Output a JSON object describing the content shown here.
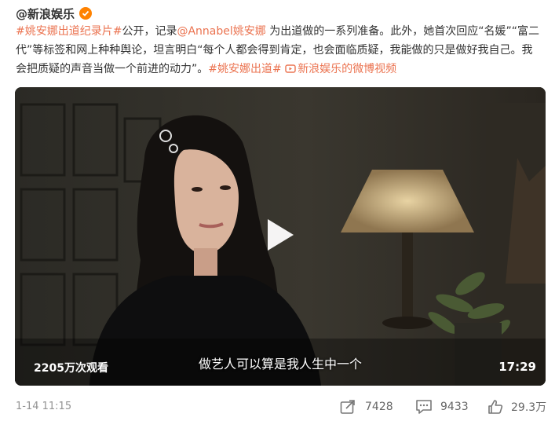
{
  "author": {
    "name": "@新浪娱乐"
  },
  "post": {
    "tag1": "#姚安娜出道纪录片#",
    "text1": "公开，记录",
    "mention": "@Annabel姚安娜",
    "text2": " 为出道做的一系列准备。此外，她首次回应“名媛”“富二代”等标签和网上种种舆论，坦言明白“每个人都会得到肯定，也会面临质疑，我能做的只是做好我自己。我会把质疑的声音当做一个前进的动力”。",
    "tag2": "#姚安娜出道#",
    "video_link": "新浪娱乐的微博视频"
  },
  "video": {
    "views": "2205万次观看",
    "subtitle": "做艺人可以算是我人生中一个",
    "duration": "17:29"
  },
  "footer": {
    "time": "1-14 11:15",
    "share_count": "7428",
    "comment_count": "9433",
    "like_count": "29.3万"
  },
  "colors": {
    "link": "#eb7350",
    "badge": "#ff8200",
    "meta": "#939393"
  }
}
